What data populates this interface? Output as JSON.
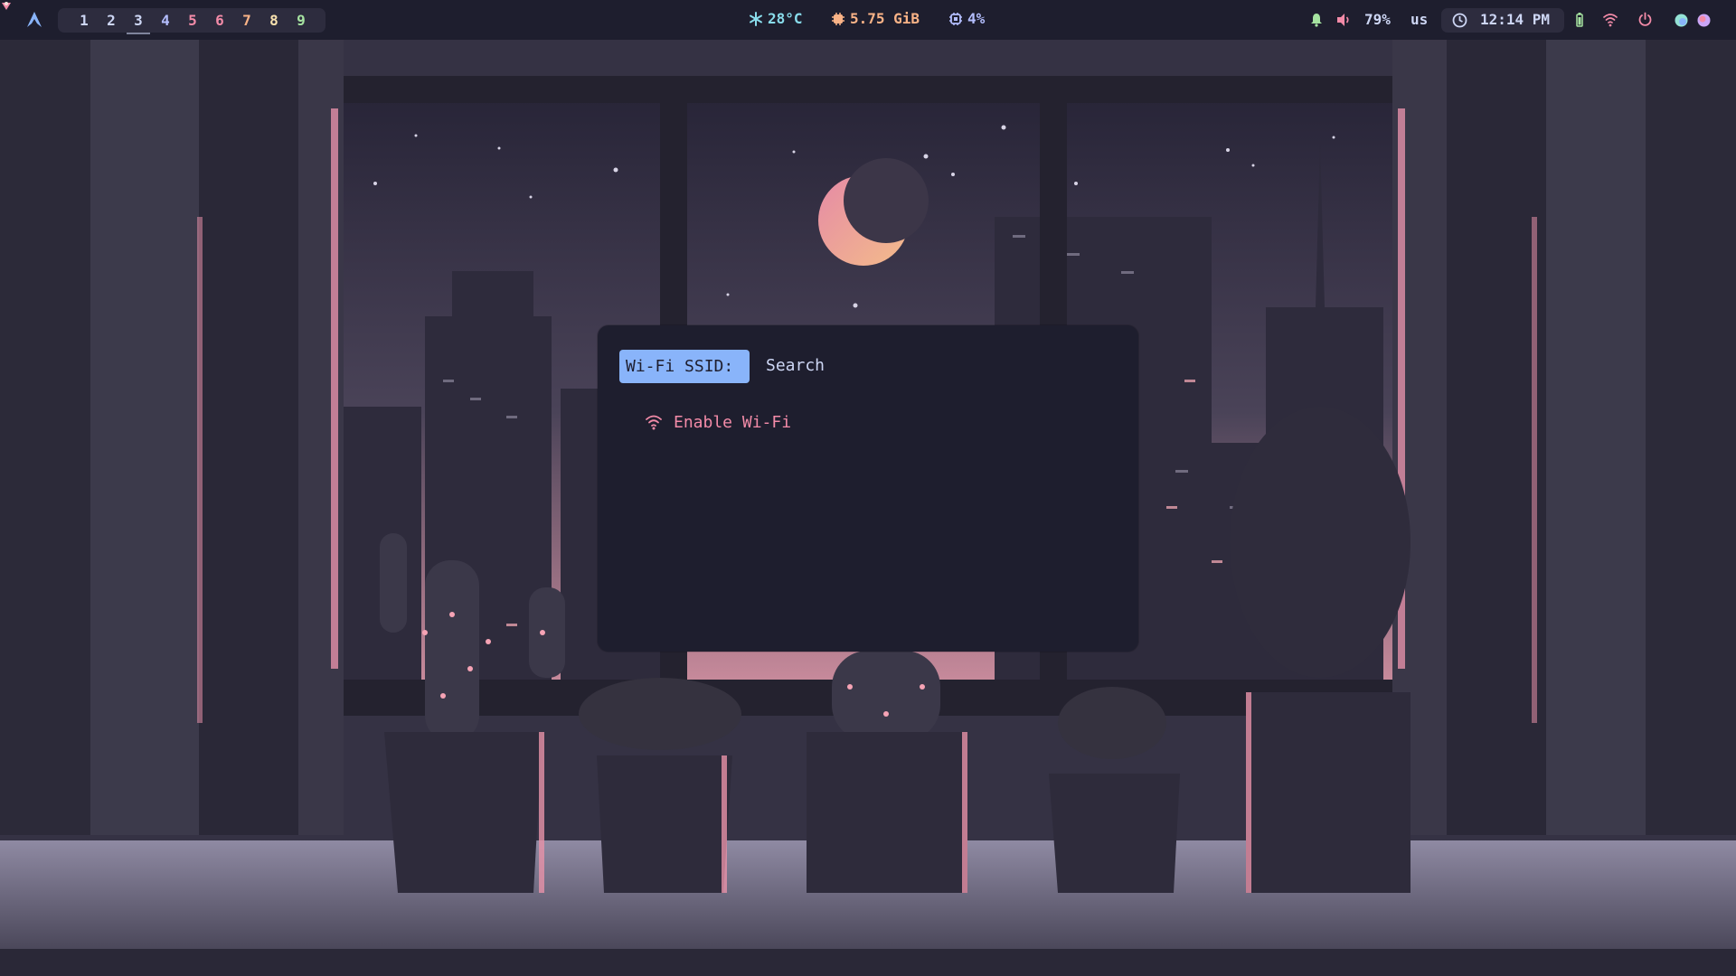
{
  "topbar": {
    "workspaces": [
      "1",
      "2",
      "3",
      "4",
      "5",
      "6",
      "7",
      "8",
      "9"
    ],
    "active_workspace": "3",
    "workspace_colors": [
      "#cdd6f4",
      "#cdd6f4",
      "#cdd6f4",
      "#b4befe",
      "#f38ba8",
      "#f38ba8",
      "#fab387",
      "#f9e2af",
      "#a6e3a1"
    ],
    "temperature": "28°C",
    "memory": "5.75 GiB",
    "cpu": "4%",
    "volume": "79%",
    "keyboard_layout": "us",
    "clock": "12:14 PM",
    "icons": {
      "launcher": "arch-logo-icon",
      "temperature": "snowflake-icon",
      "memory": "memory-chip-icon",
      "cpu": "cpu-icon",
      "notifications": "bell-icon",
      "volume": "speaker-icon",
      "clock": "clock-icon",
      "battery": "battery-icon",
      "network": "wifi-icon",
      "power": "power-icon"
    },
    "colors": {
      "bar_bg": "#1e1e2e",
      "temperature": "#89dceb",
      "memory": "#fab387",
      "cpu": "#b4befe",
      "notifications": "#a6e3a1",
      "volume": "#f38ba8",
      "power": "#f38ba8"
    }
  },
  "wifi_menu": {
    "prompt_label": "Wi-Fi SSID:",
    "search_placeholder": "Search",
    "items": [
      {
        "label": "Enable Wi-Fi",
        "icon": "wifi-icon"
      }
    ],
    "colors": {
      "prompt_bg": "#89b4fa",
      "item_text": "#f38ba8"
    }
  }
}
